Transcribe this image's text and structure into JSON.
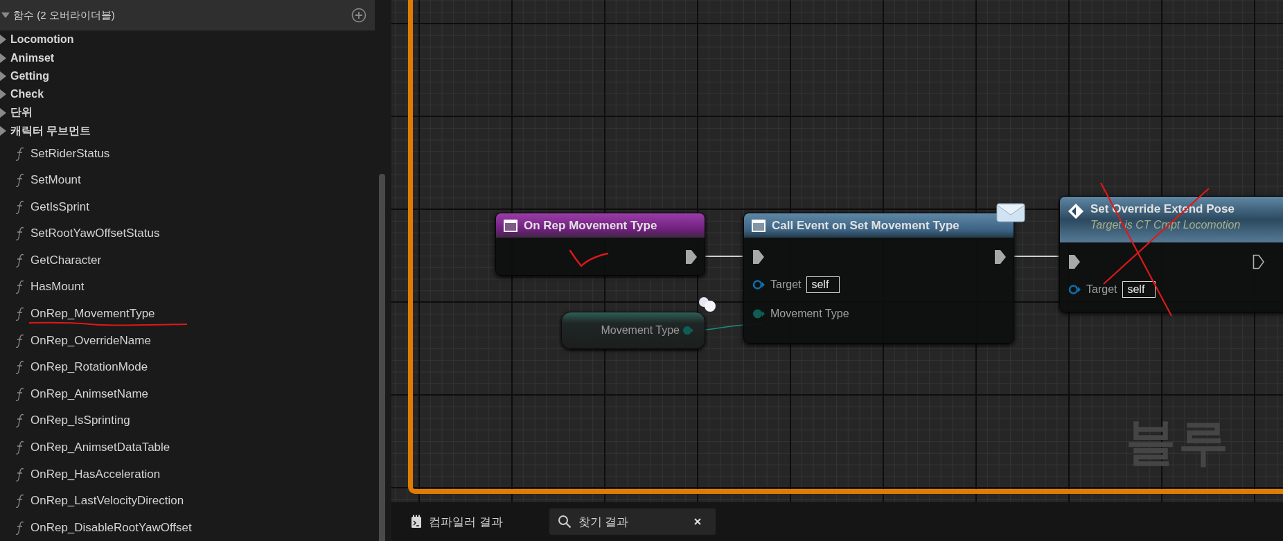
{
  "functions_panel": {
    "header": {
      "label": "함수 (2 오버라이더블)",
      "expanded": true
    },
    "categories": [
      {
        "label": "Locomotion",
        "expanded": false
      },
      {
        "label": "Animset",
        "expanded": false
      },
      {
        "label": "Getting",
        "expanded": false
      },
      {
        "label": "Check",
        "expanded": false
      },
      {
        "label": "단위",
        "expanded": false
      },
      {
        "label": "캐릭터 무브먼트",
        "expanded": false
      }
    ],
    "functions": [
      "SetRiderStatus",
      "SetMount",
      "GetIsSprint",
      "SetRootYawOffsetStatus",
      "GetCharacter",
      "HasMount",
      "OnRep_MovementType",
      "OnRep_OverrideName",
      "OnRep_RotationMode",
      "OnRep_AnimsetName",
      "OnRep_IsSprinting",
      "OnRep_AnimsetDataTable",
      "OnRep_HasAcceleration",
      "OnRep_LastVelocityDirection",
      "OnRep_DisableRootYawOffset"
    ]
  },
  "graph": {
    "nodes": [
      {
        "kind": "event",
        "title": "On Rep Movement Type",
        "exec_out": {
          "connected": true
        }
      },
      {
        "kind": "call",
        "title": "Call Event on Set Movement Type",
        "exec_in": {
          "connected": true
        },
        "exec_out": {
          "connected": true
        },
        "pins": [
          {
            "kind": "object",
            "label": "Target",
            "value": "self"
          },
          {
            "kind": "enum",
            "label": "Movement Type"
          }
        ]
      },
      {
        "kind": "function",
        "title": "Set Override Extend Pose",
        "subtitle": "Target is CT Cmpt Locomotion",
        "exec_in": {
          "connected": true
        },
        "exec_out": {
          "connected": false
        },
        "pins": [
          {
            "kind": "object",
            "label": "Target",
            "value": "self"
          }
        ]
      },
      {
        "kind": "variable",
        "title": "Movement Type"
      }
    ],
    "watermark": "블루"
  },
  "bottom_tabs": [
    {
      "kind": "compiler",
      "label": "컴파일러 결과",
      "selected": false,
      "closable": false
    },
    {
      "kind": "search",
      "label": "찾기 결과",
      "selected": true,
      "closable": true
    }
  ]
}
